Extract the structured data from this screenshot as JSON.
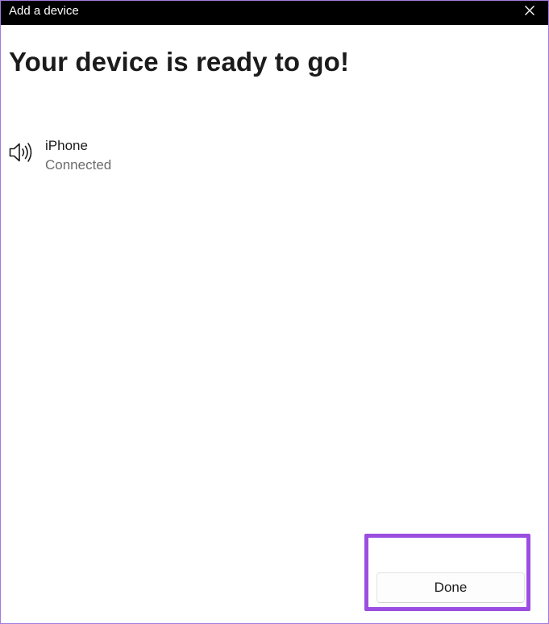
{
  "window": {
    "title": "Add a device"
  },
  "main": {
    "heading": "Your device is ready to go!",
    "device": {
      "name": "iPhone",
      "status": "Connected",
      "icon": "speaker-icon"
    }
  },
  "footer": {
    "done_label": "Done"
  },
  "colors": {
    "titlebar": "#000000",
    "highlight": "#9b4ee0",
    "window_border": "#a37be0",
    "status_text": "#6b6b6b"
  }
}
